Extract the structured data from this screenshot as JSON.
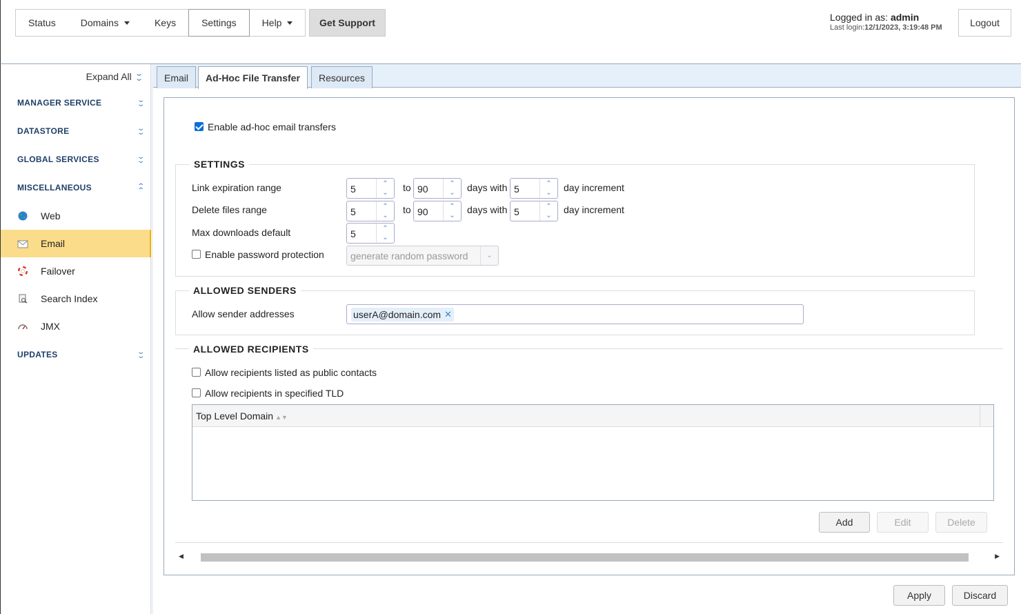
{
  "nav": {
    "items": [
      {
        "label": "Status"
      },
      {
        "label": "Domains",
        "dropdown": true
      },
      {
        "label": "Keys"
      },
      {
        "label": "Settings",
        "active": true
      },
      {
        "label": "Help",
        "dropdown": true
      }
    ],
    "support_label": "Get Support"
  },
  "user": {
    "prefix": "Logged in as: ",
    "name": "admin",
    "last_login_label": "Last login:",
    "last_login_value": "12/1/2023, 3:19:48 PM",
    "logout_label": "Logout"
  },
  "sidebar": {
    "expand_all": "Expand All",
    "sections": {
      "manager": "MANAGER SERVICE",
      "datastore": "DATASTORE",
      "global": "GLOBAL SERVICES",
      "misc": "MISCELLANEOUS",
      "updates": "UPDATES"
    },
    "items": {
      "web": "Web",
      "email": "Email",
      "failover": "Failover",
      "search": "Search Index",
      "jmx": "JMX"
    }
  },
  "tabs": {
    "email": "Email",
    "adhoc": "Ad-Hoc File Transfer",
    "resources": "Resources"
  },
  "form": {
    "enable_label": "Enable ad-hoc email transfers",
    "enable_checked": true,
    "settings": {
      "title": "SETTINGS",
      "link_label": "Link expiration range",
      "link_from": "5",
      "link_to": "90",
      "link_incr": "5",
      "delete_label": "Delete files range",
      "delete_from": "5",
      "delete_to": "90",
      "delete_incr": "5",
      "to": "to",
      "days_with": "days with",
      "day_increment": "day increment",
      "max_label": "Max downloads default",
      "max_value": "5",
      "password_label": "Enable password protection",
      "password_checked": false,
      "password_select": "generate random password"
    },
    "senders": {
      "title": "ALLOWED SENDERS",
      "label": "Allow sender addresses",
      "tag": "userA@domain.com"
    },
    "recipients": {
      "title": "ALLOWED RECIPIENTS",
      "public_label": "Allow recipients listed as public contacts",
      "tld_label": "Allow recipients in specified TLD",
      "column": "Top Level Domain",
      "add": "Add",
      "edit": "Edit",
      "delete": "Delete"
    }
  },
  "footer": {
    "apply": "Apply",
    "discard": "Discard"
  }
}
